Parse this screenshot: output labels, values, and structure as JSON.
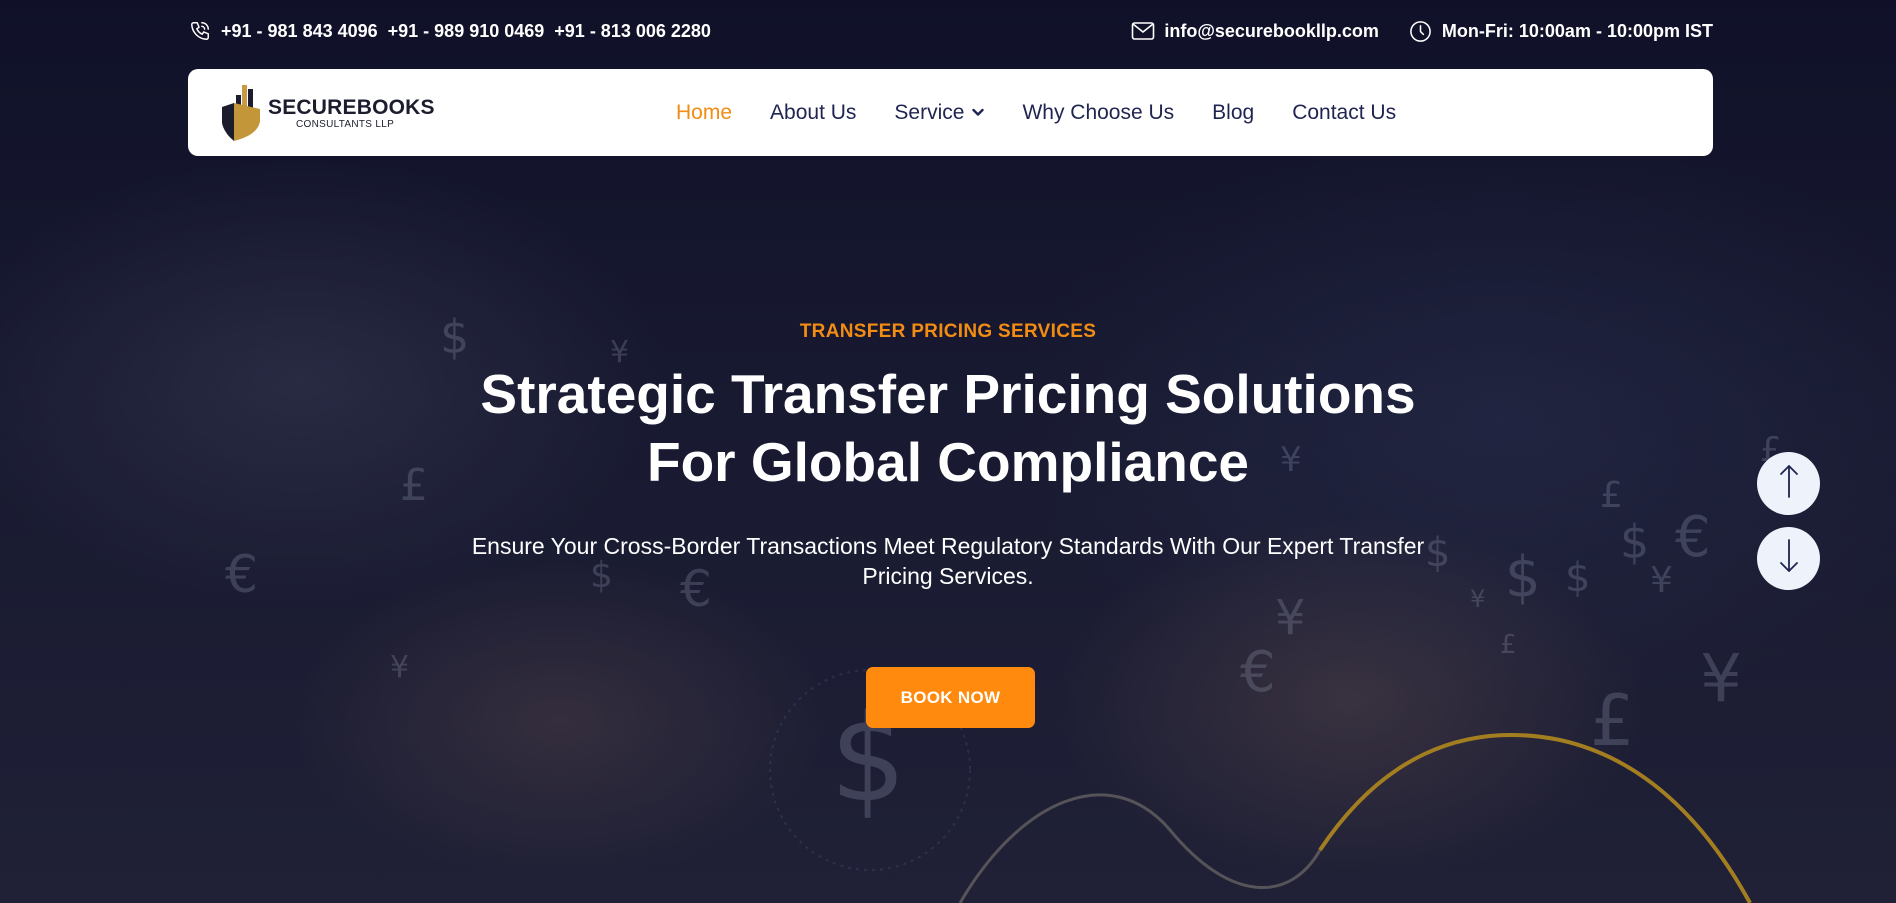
{
  "topbar": {
    "phones": [
      "+91 - 981 843 4096",
      "+91 - 989 910 0469",
      "+91 - 813 006 2280"
    ],
    "email": "info@securebookllp.com",
    "hours": "Mon-Fri: 10:00am - 10:00pm IST",
    "icons": {
      "phone": "phone-icon",
      "email": "mail-icon",
      "hours": "clock-icon"
    }
  },
  "logo": {
    "name": "SECUREBOOKS",
    "subtitle": "CONSULTANTS LLP"
  },
  "nav": {
    "items": [
      {
        "label": "Home",
        "active": true
      },
      {
        "label": "About Us"
      },
      {
        "label": "Service",
        "has_dropdown": true
      },
      {
        "label": "Why Choose Us"
      },
      {
        "label": "Blog"
      },
      {
        "label": "Contact Us"
      }
    ]
  },
  "hero": {
    "kicker": "TRANSFER PRICING SERVICES",
    "headline_line1": "Strategic Transfer Pricing Solutions",
    "headline_line2": "For Global Compliance",
    "subtitle": "Ensure Your Cross-Border Transactions Meet Regulatory Standards With Our Expert Transfer Pricing Services.",
    "cta_label": "BOOK NOW"
  },
  "scroll": {
    "up_icon": "arrow-up-icon",
    "down_icon": "arrow-down-icon"
  },
  "colors": {
    "accent": "#f28c13",
    "button": "#ff8a0d",
    "nav_text": "#1f2450",
    "background": "#15172b"
  }
}
